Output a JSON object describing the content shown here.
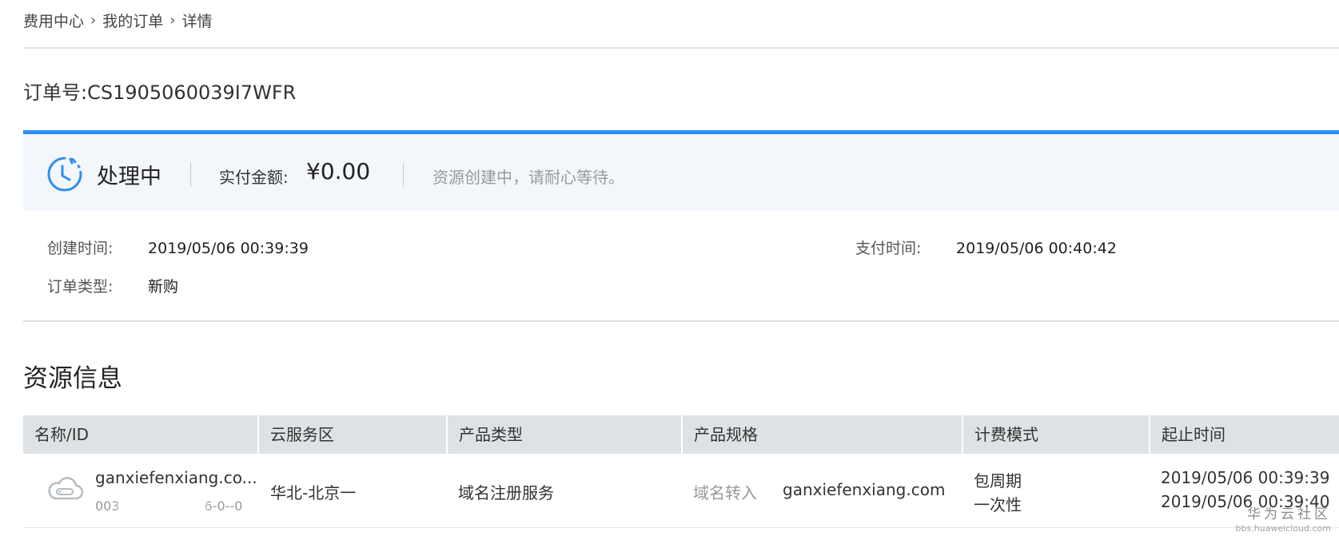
{
  "breadcrumb": {
    "items": [
      "费用中心",
      "我的订单",
      "详情"
    ],
    "separator": "›"
  },
  "order": {
    "title": "订单号:CS1905060039I7WFR"
  },
  "status": {
    "icon": "clock-processing-icon",
    "text": "处理中",
    "paid_label": "实付金额:",
    "paid_amount": "¥0.00",
    "note": "资源创建中，请耐心等待。",
    "accent_color": "#2f8ef0"
  },
  "details": {
    "created_label": "创建时间:",
    "created_value": "2019/05/06 00:39:39",
    "paid_time_label": "支付时间:",
    "paid_time_value": "2019/05/06 00:40:42",
    "type_label": "订单类型:",
    "type_value": "新购"
  },
  "resources": {
    "title": "资源信息",
    "columns": [
      "名称/ID",
      "云服务区",
      "产品类型",
      "产品规格",
      "计费模式",
      "起止时间"
    ],
    "rows": [
      {
        "icon": "cloud-resource-icon",
        "name": "ganxiefenxiang.co...",
        "id_prefix": "003",
        "id_suffix": "6-0--0",
        "region": "华北-北京一",
        "product_type": "域名注册服务",
        "spec_label": "域名转入",
        "spec_value": "ganxiefenxiang.com",
        "billing_mode_1": "包周期",
        "billing_mode_2": "一次性",
        "start_time": "2019/05/06 00:39:39",
        "end_time": "2019/05/06 00:39:40"
      }
    ]
  },
  "watermark": {
    "line1": "华为云社区",
    "line2": "bbs.huaweicloud.com"
  }
}
